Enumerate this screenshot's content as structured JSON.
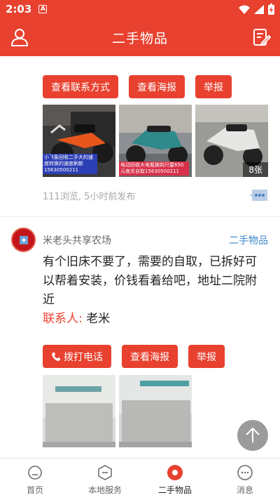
{
  "status_bar": {
    "time": "2:03",
    "app_badge": "A"
  },
  "header": {
    "title": "二手物品"
  },
  "post1": {
    "buttons": [
      "查看联系方式",
      "查看海报",
      "举报"
    ],
    "images": [
      {
        "caption": "小飞象回收二手大的速度转换的速度刷新15630500211"
      },
      {
        "caption": "电动回收大电瓶换购只要650元南关自取15630500211"
      },
      {
        "badge": "8张"
      }
    ],
    "meta": "111浏览, 5小时前发布"
  },
  "post2": {
    "author": "米老头共享农场",
    "category": "二手物品",
    "text": "有个旧床不要了，需要的自取，已拆好可以帮着安装，价钱看着给吧，地址二院附近",
    "contact_label": "联系人:",
    "contact_name": "老米",
    "buttons": [
      "拨打电话",
      "查看海报",
      "举报"
    ]
  },
  "tabs": [
    {
      "label": "首页",
      "icon": "home-icon"
    },
    {
      "label": "本地服务",
      "icon": "service-icon"
    },
    {
      "label": "二手物品",
      "icon": "secondhand-icon",
      "active": true
    },
    {
      "label": "消息",
      "icon": "message-icon"
    }
  ],
  "colors": {
    "accent": "#e8412f",
    "link": "#3d86c6",
    "muted": "#aaaaaa"
  }
}
